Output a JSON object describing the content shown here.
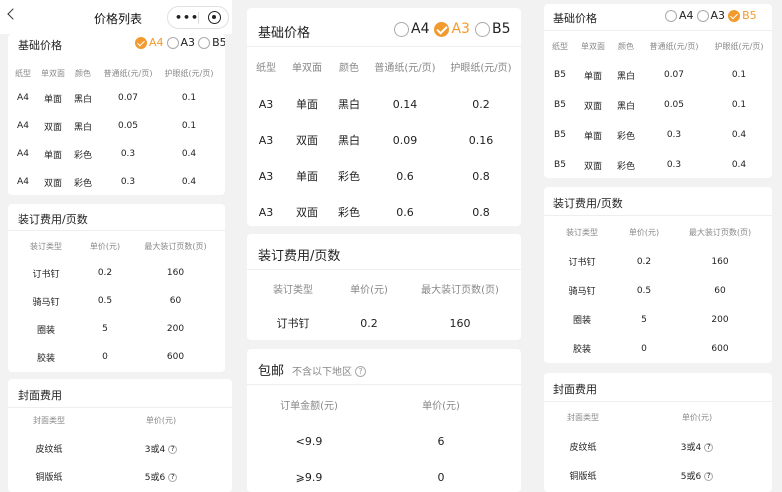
{
  "nav": {
    "title": "价格列表"
  },
  "options": [
    "A4",
    "A3",
    "B5"
  ],
  "base": {
    "title": "基础价格",
    "headers": [
      "纸型",
      "单双面",
      "颜色",
      "普通纸(元/页)",
      "护眼纸(元/页)"
    ],
    "sides": [
      "单面",
      "双面",
      "单面",
      "双面"
    ],
    "colors": [
      "黑白",
      "黑白",
      "彩色",
      "彩色"
    ]
  },
  "panels": [
    {
      "selected": "A4",
      "paper": "A4",
      "normal": [
        "0.07",
        "0.05",
        "0.3",
        "0.3"
      ],
      "eye": [
        "0.1",
        "0.1",
        "0.4",
        "0.4"
      ]
    },
    {
      "selected": "A3",
      "paper": "A3",
      "normal": [
        "0.14",
        "0.09",
        "0.6",
        "0.6"
      ],
      "eye": [
        "0.2",
        "0.16",
        "0.8",
        "0.8"
      ]
    },
    {
      "selected": "B5",
      "paper": "B5",
      "normal": [
        "0.07",
        "0.05",
        "0.3",
        "0.3"
      ],
      "eye": [
        "0.1",
        "0.1",
        "0.4",
        "0.4"
      ]
    }
  ],
  "binding": {
    "title": "装订费用/页数",
    "headers": [
      "装订类型",
      "单价(元)",
      "最大装订页数(页)"
    ],
    "rows": [
      [
        "订书钉",
        "0.2",
        "160"
      ],
      [
        "骑马钉",
        "0.5",
        "60"
      ],
      [
        "圈装",
        "5",
        "200"
      ],
      [
        "胶装",
        "0",
        "600"
      ]
    ]
  },
  "cover": {
    "title": "封面费用",
    "headers": [
      "封面类型",
      "单价(元)"
    ],
    "rows": [
      [
        "皮纹纸",
        "3或4"
      ],
      [
        "铜版纸",
        "5或6"
      ]
    ]
  },
  "shipping": {
    "title": "包邮",
    "subtitle": "不含以下地区",
    "headers": [
      "订单金额(元)",
      "单价(元)"
    ],
    "rows": [
      [
        "<9.9",
        "6"
      ],
      [
        "⩾9.9",
        "0"
      ]
    ]
  },
  "icons": {
    "back": "back-arrow-icon",
    "more": "more-dots-icon",
    "close": "target-icon",
    "help": "question-icon"
  },
  "colors": {
    "accent": "#f29a2e",
    "background": "#f2f2f2",
    "card": "#ffffff"
  }
}
